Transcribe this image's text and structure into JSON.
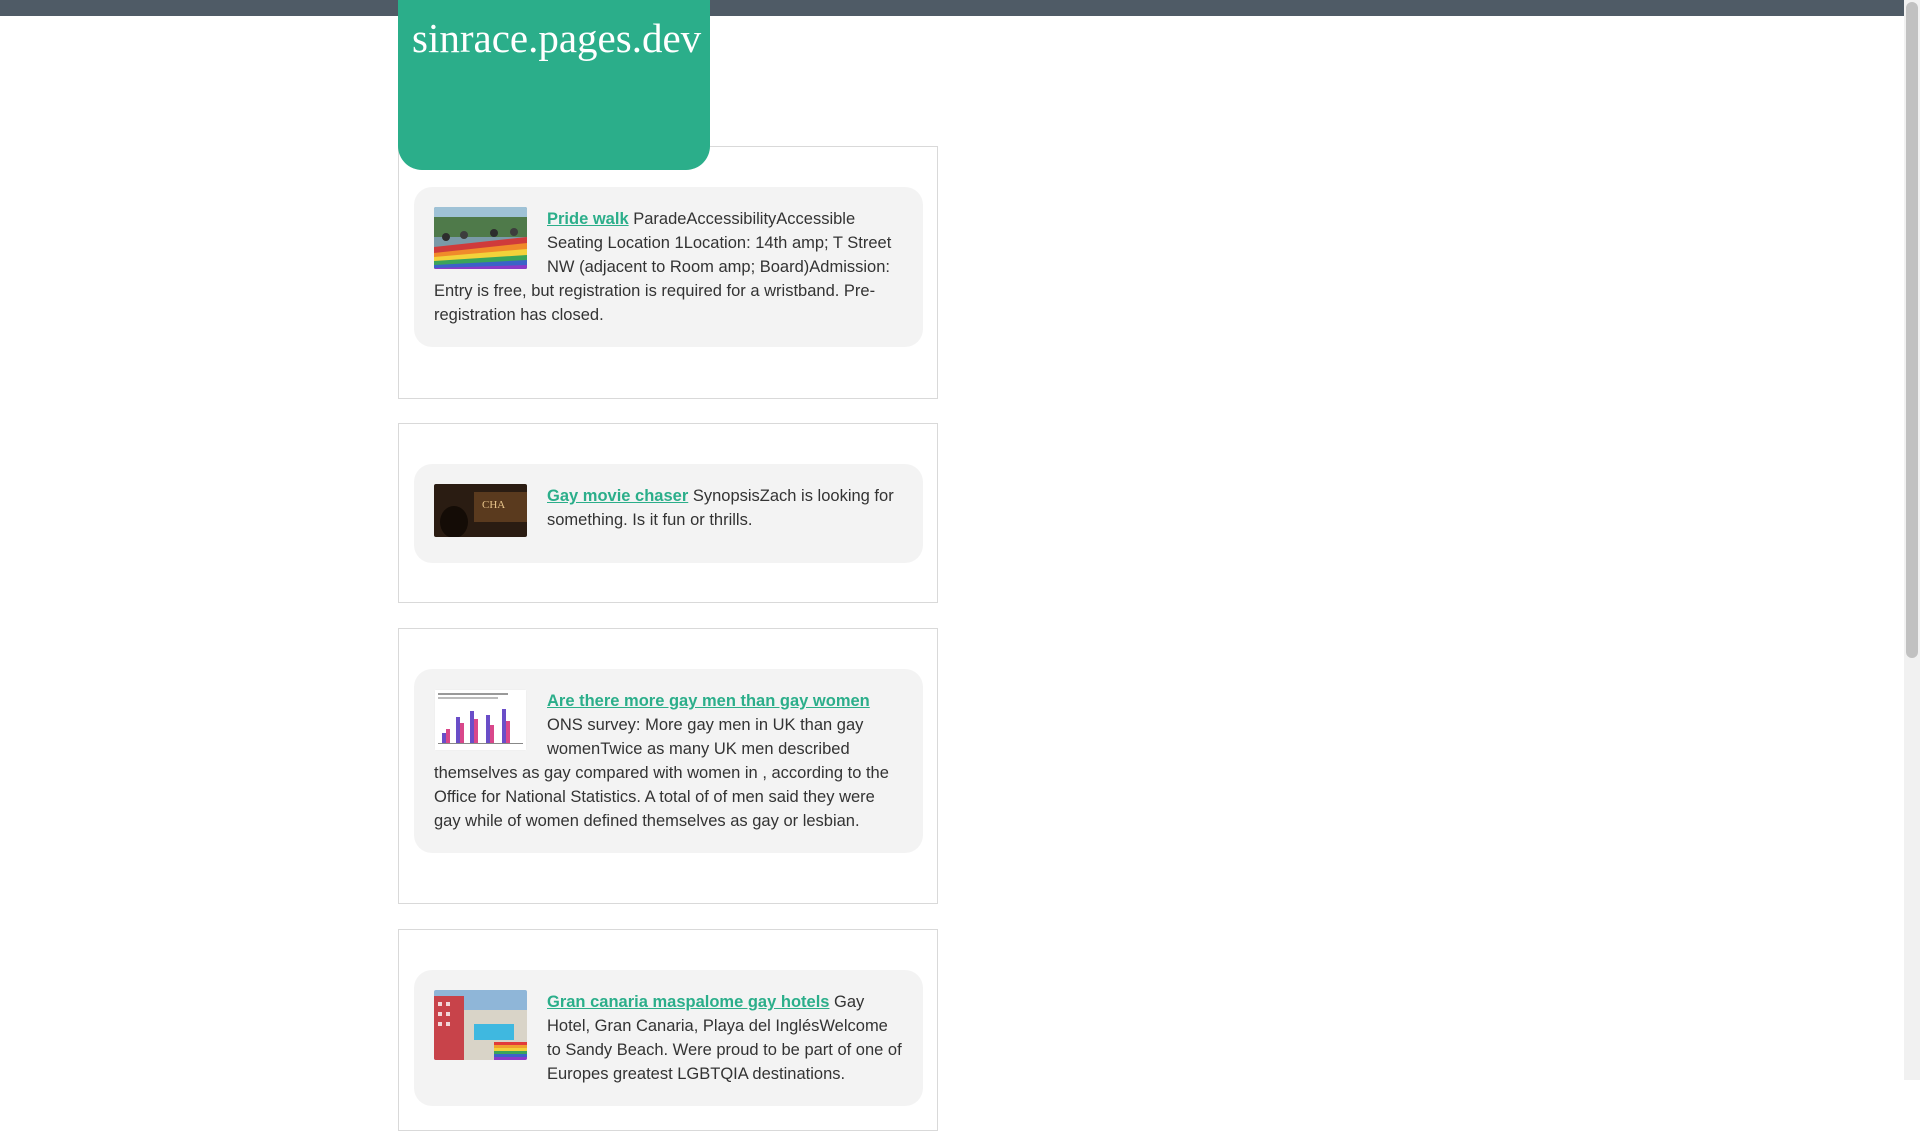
{
  "site": {
    "title": "sinrace.pages.dev"
  },
  "posts": [
    {
      "title": "Pride walk",
      "text": "ParadeAccessibilityAccessible Seating Location 1Location: 14th amp; T Street NW (adjacent to Room amp; Board)Admission: Entry is free, but registration is required for a wristband. Pre-registration has closed.",
      "thumb_icon": "pride-parade-photo"
    },
    {
      "title": "Gay movie chaser",
      "text": "SynopsisZach is looking for something. Is it fun or thrills.",
      "thumb_icon": "movie-still-photo",
      "thumb_text": "CHA"
    },
    {
      "title": "Are there more gay men than gay women",
      "text": "ONS survey: More gay men in UK than gay womenTwice as many UK men described themselves as gay compared with women in , according to the Office for National Statistics. A total of of men said they were gay while of women defined themselves as gay or lesbian.",
      "thumb_icon": "bar-chart-image"
    },
    {
      "title": "Gran canaria maspalome gay hotels",
      "text": "Gay Hotel, Gran Canaria, Playa del InglésWelcome to Sandy Beach. Were proud to be part of one of Europes greatest LGBTQIA destinations.",
      "thumb_icon": "hotel-pool-photo"
    }
  ],
  "colors": {
    "accent": "#2bae8a",
    "top_strip": "#4f5b66",
    "card_bg": "#f3f3f3"
  }
}
